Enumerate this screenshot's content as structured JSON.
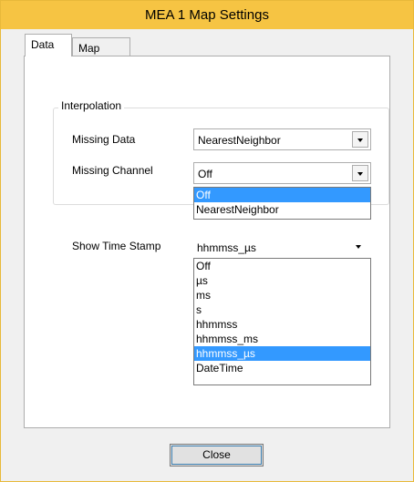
{
  "window": {
    "title": "MEA 1  Map Settings"
  },
  "tabs": [
    {
      "label": "Data",
      "selected": true
    },
    {
      "label": "Map",
      "selected": false
    }
  ],
  "interpolation": {
    "group_title": "Interpolation",
    "missing_data": {
      "label": "Missing Data",
      "value": "NearestNeighbor"
    },
    "missing_channel": {
      "label": "Missing Channel",
      "value": "Off",
      "options": [
        "Off",
        "NearestNeighbor"
      ],
      "highlighted": "Off"
    }
  },
  "timestamp": {
    "label": "Show Time Stamp",
    "value": "hhmmss_µs",
    "options": [
      "Off",
      "µs",
      "ms",
      "s",
      "hhmmss",
      "hhmmss_ms",
      "hhmmss_µs",
      "DateTime"
    ],
    "highlighted": "hhmmss_µs"
  },
  "buttons": {
    "close": "Close"
  },
  "colors": {
    "titlebar": "#f6c443",
    "selection": "#3399ff"
  }
}
